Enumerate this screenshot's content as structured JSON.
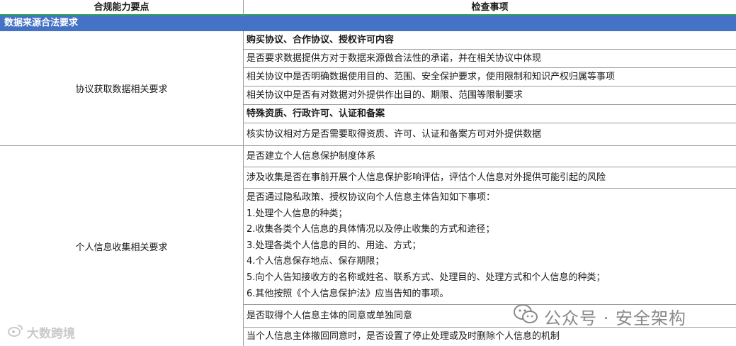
{
  "header": {
    "col_left": "合规能力要点",
    "col_right": "检查事项"
  },
  "section": {
    "title": "数据来源合法要求"
  },
  "groups": [
    {
      "label": "协议获取数据相关要求",
      "items": [
        {
          "text": "购买协议、合作协议、授权许可内容",
          "bold": true
        },
        {
          "text": "是否要求数据提供方对于数据来源做合法性的承诺，并在相关协议中体现",
          "bold": false
        },
        {
          "text": "相关协议中是否明确数据使用目的、范围、安全保护要求，使用限制和知识产权归属等事项",
          "bold": false
        },
        {
          "text": "相关协议中是否有对数据对外提供作出目的、期限、范围等限制要求",
          "bold": false
        },
        {
          "text": "特殊资质、行政许可、认证和备案",
          "bold": true
        },
        {
          "text": "核实协议相对方是否需要取得资质、许可、认证和备案方可对外提供数据",
          "bold": false
        }
      ]
    },
    {
      "label": "个人信息收集相关要求",
      "items": [
        {
          "text": "是否建立个人信息保护制度体系"
        },
        {
          "text": "涉及收集是否在事前开展个人信息保护影响评估，评估个人信息对外提供可能引起的风险"
        },
        {
          "lines": [
            "是否通过隐私政策、授权协议向个人信息主体告知如下事项：",
            "1.处理个人信息的种类；",
            "2.收集各类个人信息的具体情况以及停止收集的方式和途径；",
            "3.处理各类个人信息的目的、用途、方式；",
            "4.个人信息保存地点、保存期限；",
            "5.向个人告知接收方的名称或姓名、联系方式、处理目的、处理方式和个人信息的种类；",
            "6.其他按照《个人信息保护法》应当告知的事项。"
          ]
        },
        {
          "text": "是否取得个人信息主体的同意或单独同意"
        },
        {
          "text": "当个人信息主体撤回同意时，是否设置了停止处理或及时删除个人信息的机制"
        }
      ]
    }
  ],
  "watermarks": {
    "left_text": "大数跨境",
    "right_text": "公众号 · 安全架构",
    "left_icon": "weibo-like-logo-icon",
    "right_icon": "wechat-icon"
  }
}
